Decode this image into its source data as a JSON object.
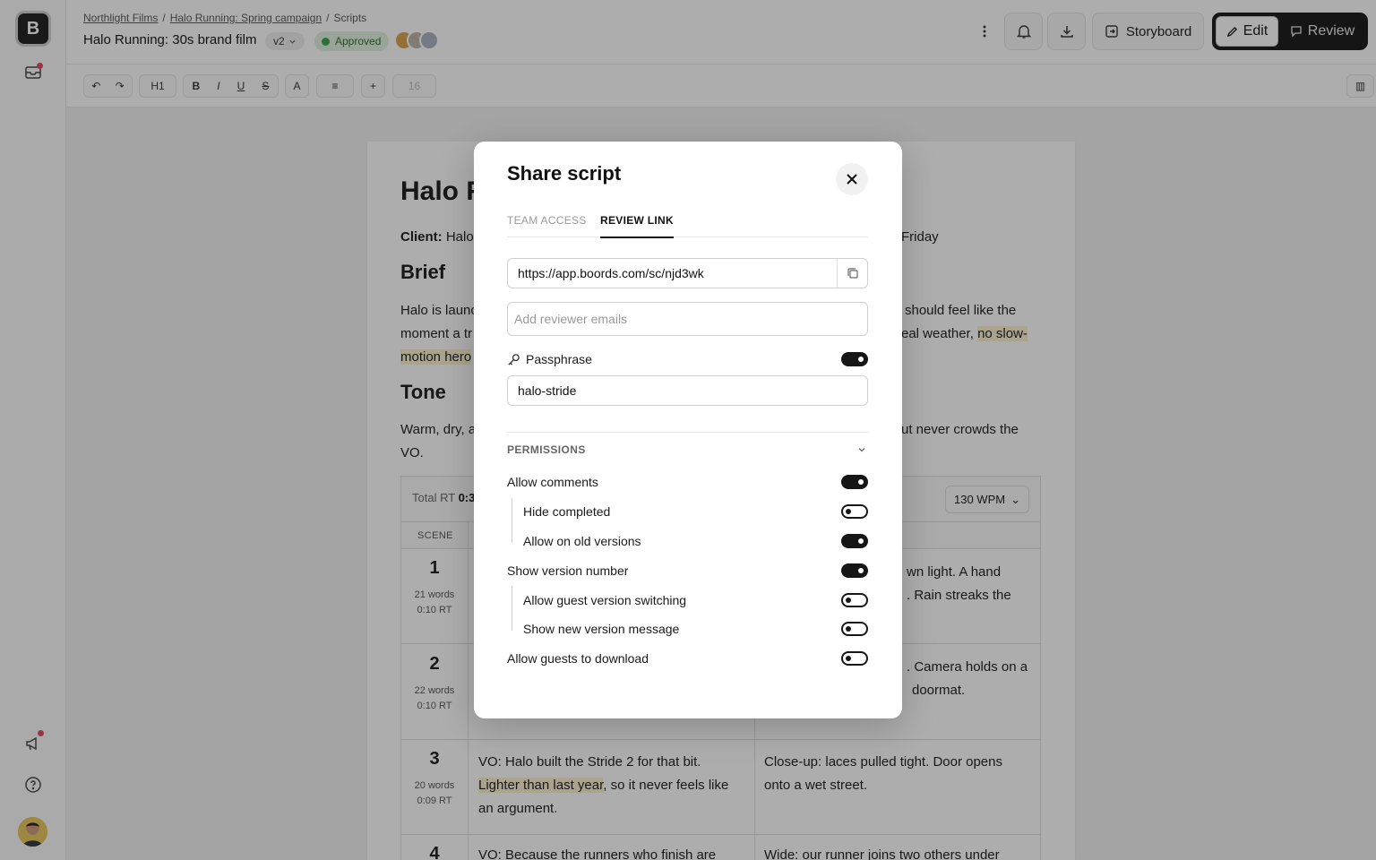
{
  "app": {
    "logo_letter": "B"
  },
  "breadcrumb": [
    "Northlight Films",
    "Halo Running: Spring campaign",
    "Scripts"
  ],
  "doc": {
    "title": "Halo Running: 30s brand film",
    "version": "v2",
    "status": "Approved"
  },
  "header": {
    "storyboard": "Storyboard",
    "edit": "Edit",
    "review": "Review"
  },
  "toolbar": {
    "heading": "H1",
    "bold": "B",
    "italic": "I",
    "underline": "U",
    "strike": "S",
    "text_color": "A",
    "insert": "+",
    "font_size": "16"
  },
  "script": {
    "title": "Halo R",
    "client_label": "Client:",
    "client_value": "Halo",
    "client_tail": "Friday",
    "brief_heading": "Brief",
    "brief_l1a": "Halo is launc",
    "brief_l1b": "should feel like the",
    "brief_l2a": "moment a tr",
    "brief_l2b": "eal weather,",
    "brief_l2c": "no slow-",
    "brief_l3a": "motion hero",
    "tone_heading": "Tone",
    "tone_l1a": "Warm, dry, a",
    "tone_l1b": "ut never crowds the",
    "tone_l2": "VO.",
    "total_rt_label": "Total RT",
    "total_rt_value": "0:3",
    "wpm": "130 WPM",
    "scene_col": "SCENE",
    "scenes": [
      {
        "num": "1",
        "words": "21 words",
        "rt": "0:10 RT",
        "visual_a": "wn light. A hand",
        "visual_b": ". Rain streaks the"
      },
      {
        "num": "2",
        "words": "22 words",
        "rt": "0:10 RT",
        "visual_a": ". Camera holds on a",
        "visual_b": "doormat."
      },
      {
        "num": "3",
        "words": "20 words",
        "rt": "0:09 RT",
        "vo_a": "VO: Halo built the Stride 2 for that bit.",
        "vo_hl": "Lighter than last year",
        "vo_b": ", so it never feels like",
        "vo_c": "an argument.",
        "visual_a": "Close-up: laces pulled tight. Door opens",
        "visual_b": "onto a wet street."
      },
      {
        "num": "4",
        "vo_a": "VO: Because the runners who finish are",
        "visual_a": "Wide: our runner joins two others under"
      }
    ]
  },
  "modal": {
    "title": "Share script",
    "tabs": [
      "TEAM ACCESS",
      "REVIEW LINK"
    ],
    "link": "https://app.boords.com/sc/njd3wk",
    "emails_placeholder": "Add reviewer emails",
    "passphrase_label": "Passphrase",
    "passphrase_value": "halo-stride",
    "permissions_label": "PERMISSIONS",
    "perms": [
      {
        "label": "Allow comments",
        "on": true,
        "sub": false
      },
      {
        "label": "Hide completed",
        "on": false,
        "sub": true
      },
      {
        "label": "Allow on old versions",
        "on": true,
        "sub": true
      },
      {
        "label": "Show version number",
        "on": true,
        "sub": false
      },
      {
        "label": "Allow guest version switching",
        "on": false,
        "sub": true
      },
      {
        "label": "Show new version message",
        "on": false,
        "sub": true
      },
      {
        "label": "Allow guests to download",
        "on": false,
        "sub": false
      }
    ]
  }
}
